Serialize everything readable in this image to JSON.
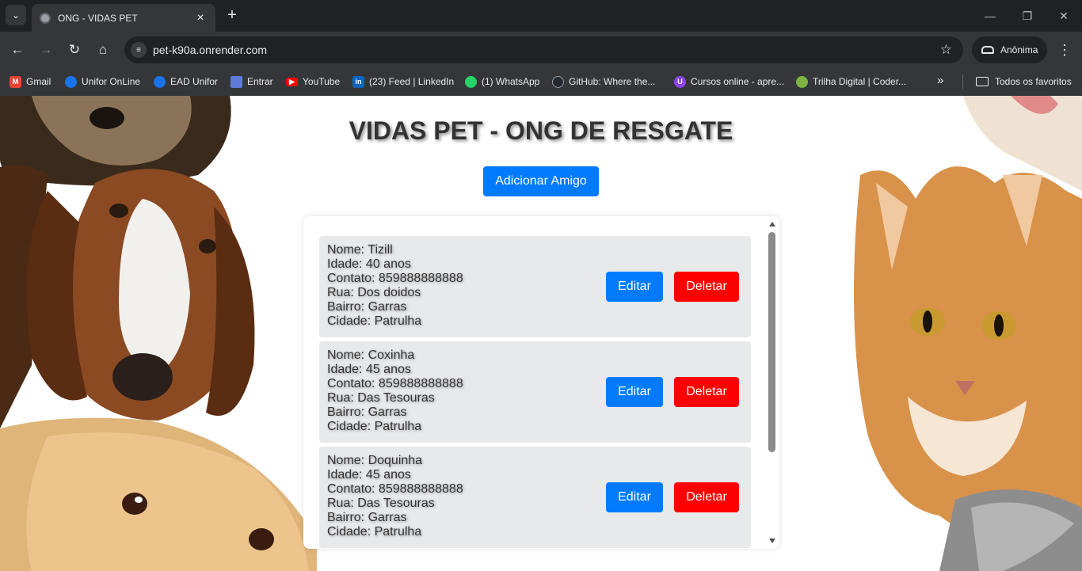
{
  "browser": {
    "tab_title": "ONG - VIDAS PET",
    "new_tab": "+",
    "url": "pet-k90a.onrender.com",
    "profile_label": "Anônima",
    "bookmarks": [
      {
        "label": "Gmail",
        "icon": "gmail-icon",
        "color": "#ea4335"
      },
      {
        "label": "Unifor OnLine",
        "icon": "unifor-icon",
        "color": "#1a73e8"
      },
      {
        "label": "EAD Unifor",
        "icon": "ead-unifor-icon",
        "color": "#1a73e8"
      },
      {
        "label": "Entrar",
        "icon": "entrar-icon",
        "color": "#5c7bd9"
      },
      {
        "label": "YouTube",
        "icon": "youtube-icon",
        "color": "#ff0000"
      },
      {
        "label": "(23) Feed | LinkedIn",
        "icon": "linkedin-icon",
        "color": "#0a66c2"
      },
      {
        "label": "(1) WhatsApp",
        "icon": "whatsapp-icon",
        "color": "#25d366"
      },
      {
        "label": "GitHub: Where the...",
        "icon": "github-icon",
        "color": "#24292f"
      },
      {
        "label": "Cursos online - apre...",
        "icon": "cursos-icon",
        "color": "#8e44ec"
      },
      {
        "label": "Trilha Digital | Coder...",
        "icon": "trilha-icon",
        "color": "#7cb342"
      }
    ],
    "all_bookmarks_label": "Todos os favoritos"
  },
  "page": {
    "title": "VIDAS PET - ONG DE RESGATE",
    "add_button": "Adicionar Amigo",
    "pets": [
      {
        "nome": "Nome: Tizill",
        "idade": "Idade: 40 anos",
        "contato": "Contato: 859888888888",
        "rua": "Rua: Dos doidos",
        "bairro": "Bairro: Garras",
        "cidade": "Cidade: Patrulha",
        "edit": "Editar",
        "delete": "Deletar"
      },
      {
        "nome": "Nome: Coxinha",
        "idade": "Idade: 45 anos",
        "contato": "Contato: 859888888888",
        "rua": "Rua: Das Tesouras",
        "bairro": "Bairro: Garras",
        "cidade": "Cidade: Patrulha",
        "edit": "Editar",
        "delete": "Deletar"
      },
      {
        "nome": "Nome: Doquinha",
        "idade": "Idade: 45 anos",
        "contato": "Contato: 859888888888",
        "rua": "Rua: Das Tesouras",
        "bairro": "Bairro: Garras",
        "cidade": "Cidade: Patrulha",
        "edit": "Editar",
        "delete": "Deletar"
      }
    ]
  },
  "colors": {
    "primary": "#007bff",
    "danger": "#ff0000",
    "card_bg": "#e8e9eb"
  }
}
